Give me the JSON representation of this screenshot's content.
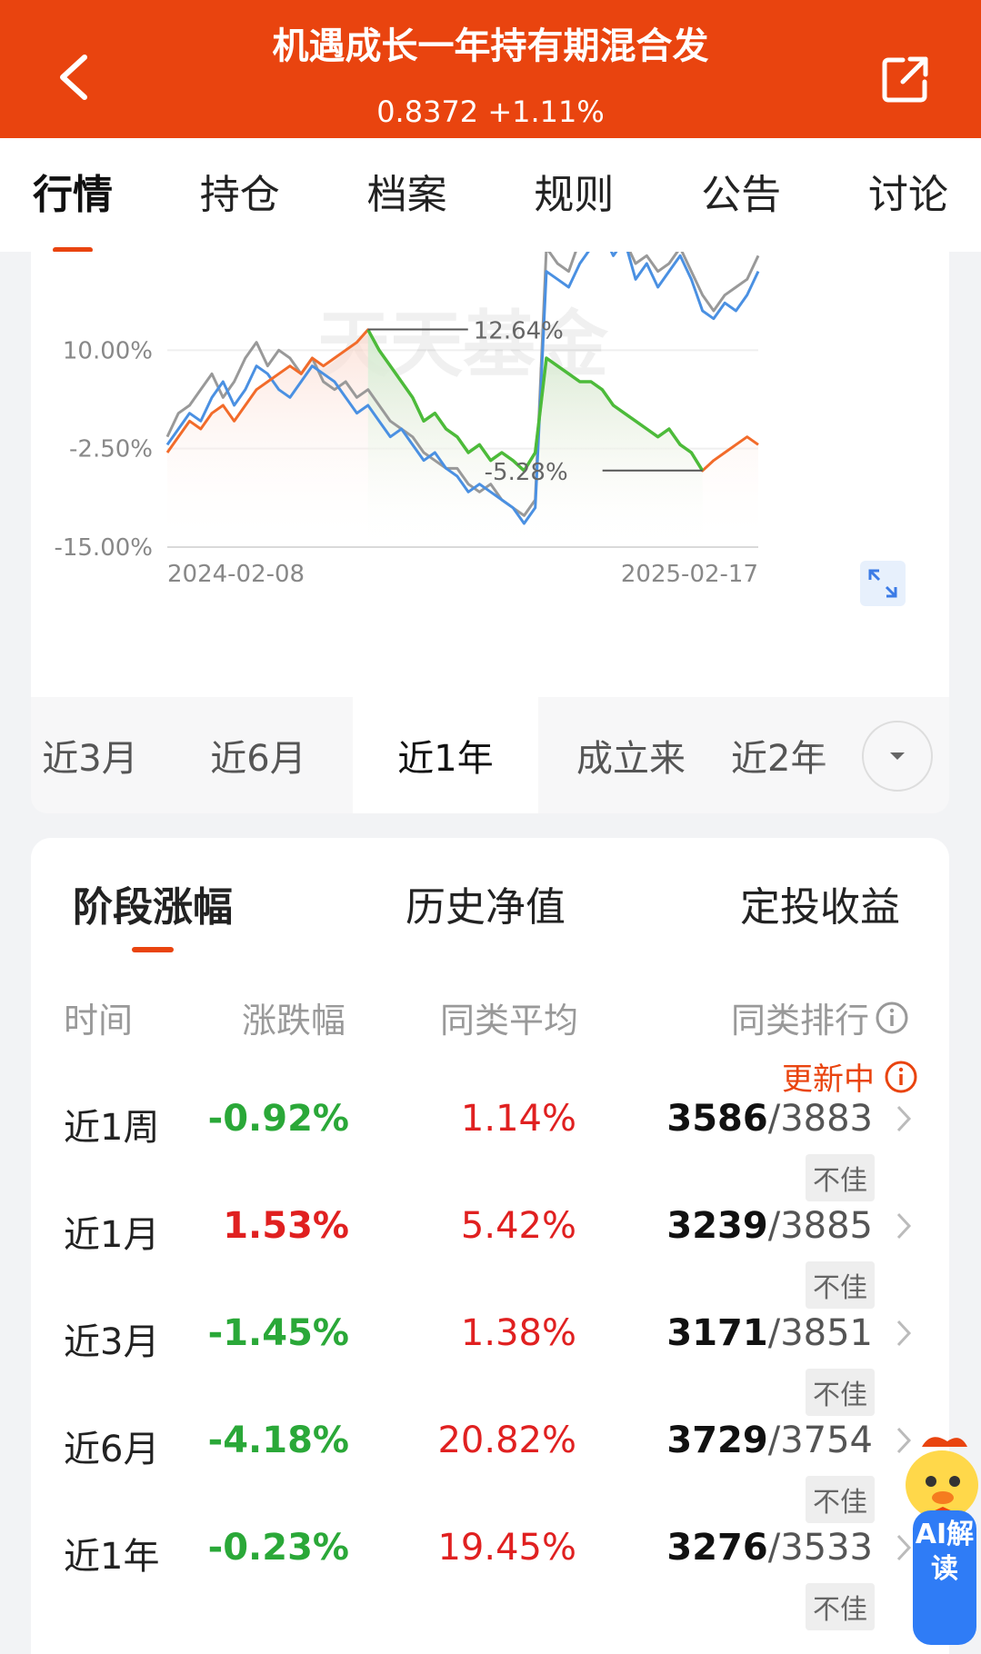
{
  "header": {
    "title": "机遇成长一年持有期混合发",
    "nav_value": "0.8372",
    "nav_change": "+1.11%"
  },
  "tabs": [
    {
      "label": "行情",
      "active": true
    },
    {
      "label": "持仓"
    },
    {
      "label": "档案"
    },
    {
      "label": "规则"
    },
    {
      "label": "公告"
    },
    {
      "label": "讨论"
    }
  ],
  "chart_data": {
    "type": "line",
    "watermark": "天天基金",
    "y_ticks": [
      "10.00%",
      "-2.50%",
      "-15.00%"
    ],
    "ylim": [
      -15,
      22.5
    ],
    "x_labels": [
      "2024-02-08",
      "2025-02-17"
    ],
    "annotations": [
      {
        "text": "12.64%",
        "kind": "max"
      },
      {
        "text": "-5.28%",
        "kind": "min"
      }
    ],
    "series": [
      {
        "color": "#4a90e2",
        "values": [
          -2,
          0,
          2,
          1,
          4,
          6,
          3,
          5,
          8,
          7,
          5,
          4,
          6,
          8,
          7,
          6,
          4,
          2,
          3,
          1,
          -1,
          0,
          -2,
          -4,
          -3,
          -5,
          -6,
          -8,
          -7,
          -8,
          -9,
          -10,
          -12,
          -10,
          20,
          19,
          18,
          21,
          23,
          25,
          22,
          24,
          19,
          21,
          18,
          20,
          22,
          19,
          15,
          14,
          16,
          15,
          17,
          20
        ]
      },
      {
        "color": "#999999",
        "values": [
          -1,
          2,
          3,
          5,
          7,
          4,
          6,
          9,
          11,
          8,
          10,
          9,
          7,
          9,
          6,
          5,
          6,
          4,
          5,
          3,
          1,
          0,
          -1,
          -3,
          -4,
          -5,
          -5,
          -7,
          -8,
          -7,
          -9,
          -10,
          -11,
          -9,
          23,
          21,
          20,
          24,
          26,
          25,
          23,
          24,
          21,
          22,
          20,
          21,
          23,
          20,
          17,
          15,
          17,
          18,
          19,
          22
        ]
      },
      {
        "color": "#f26b2a",
        "values": [
          -3,
          -1,
          1,
          0,
          2,
          3,
          1,
          3,
          5,
          6,
          7,
          8,
          7,
          9,
          8,
          9,
          10,
          11,
          12.6,
          10,
          8,
          6,
          4,
          1,
          2,
          0,
          -1,
          -3,
          -2,
          -4,
          -3,
          -4,
          -5.3,
          -3,
          9,
          8,
          7,
          6,
          6,
          5,
          3,
          2,
          1,
          0,
          -1,
          0,
          -2,
          -3,
          -5.3,
          -4,
          -3,
          -2,
          -1,
          -2
        ]
      }
    ],
    "drawdown_range": {
      "start_index": 18,
      "end_index": 48
    }
  },
  "periods": [
    {
      "label": "近3月"
    },
    {
      "label": "近6月"
    },
    {
      "label": "近1年",
      "active": true
    },
    {
      "label": "成立来"
    },
    {
      "label": "近2年"
    }
  ],
  "returns": {
    "tabs": [
      {
        "label": "阶段涨幅",
        "active": true
      },
      {
        "label": "历史净值"
      },
      {
        "label": "定投收益"
      }
    ],
    "headers": {
      "period": "时间",
      "change": "涨跌幅",
      "avg": "同类平均",
      "rank": "同类排行"
    },
    "updating": "更新中",
    "rows": [
      {
        "period": "近1周",
        "change": "-0.92%",
        "avg": "1.14%",
        "rank": "3586",
        "total": "3883",
        "badge": "不佳"
      },
      {
        "period": "近1月",
        "change": "1.53%",
        "avg": "5.42%",
        "rank": "3239",
        "total": "3885",
        "badge": "不佳"
      },
      {
        "period": "近3月",
        "change": "-1.45%",
        "avg": "1.38%",
        "rank": "3171",
        "total": "3851",
        "badge": "不佳"
      },
      {
        "period": "近6月",
        "change": "-4.18%",
        "avg": "20.82%",
        "rank": "3729",
        "total": "3754",
        "badge": "不佳"
      },
      {
        "period": "近1年",
        "change": "-0.23%",
        "avg": "19.45%",
        "rank": "3276",
        "total": "3533",
        "badge": "不佳"
      }
    ]
  },
  "ai": {
    "label": "AI解读"
  }
}
